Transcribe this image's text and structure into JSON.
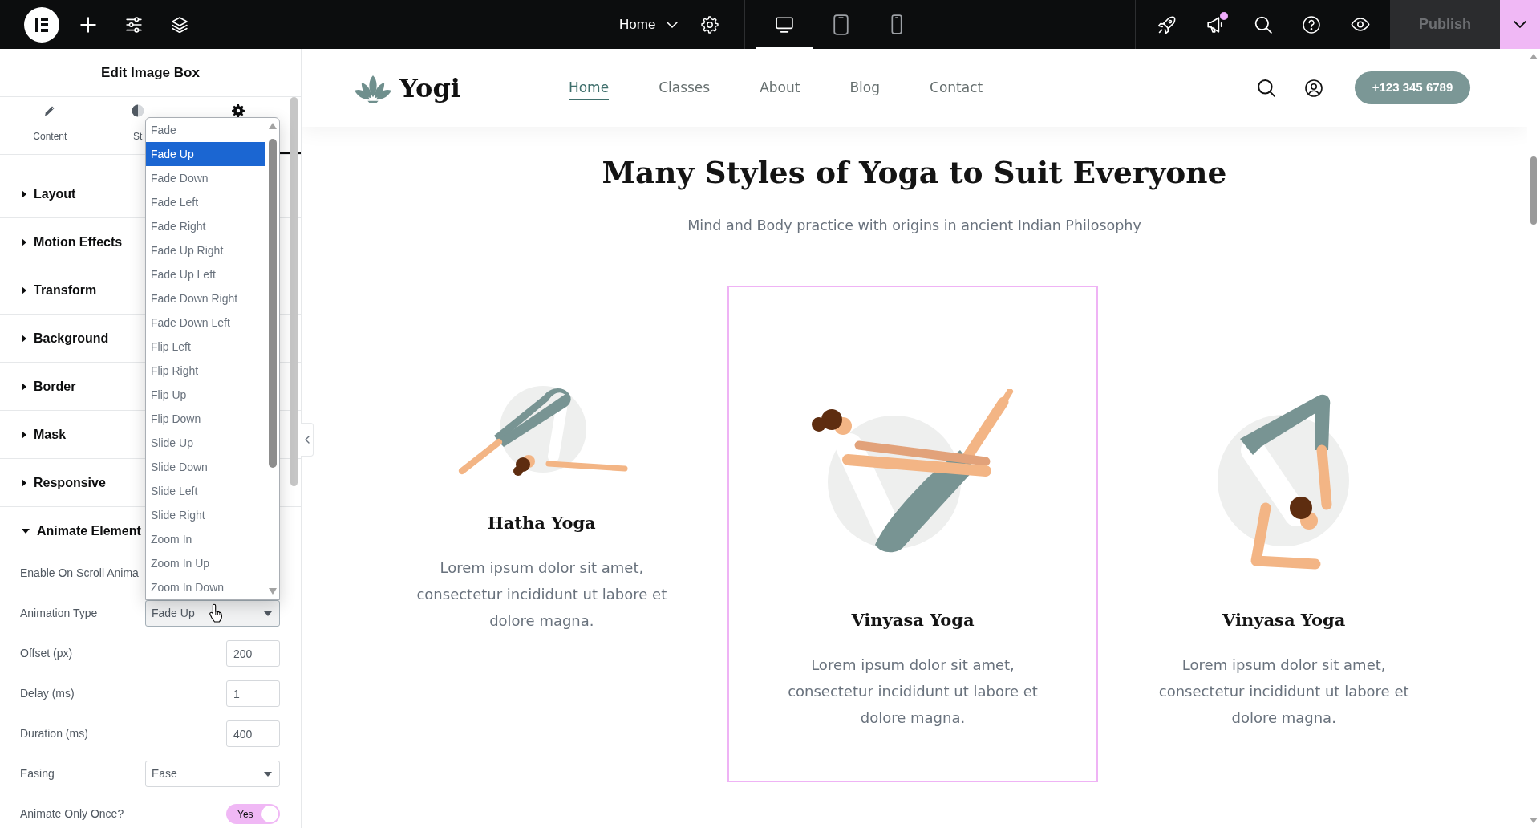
{
  "top_bar": {
    "page_selector": {
      "label": "Home"
    },
    "devices": [
      {
        "kind": "desktop",
        "selected": true
      },
      {
        "kind": "tablet",
        "selected": false
      },
      {
        "kind": "mobile",
        "selected": false
      }
    ],
    "announcements": {
      "unread": true
    },
    "publish_button": {
      "label": "Publish",
      "disabled": true
    }
  },
  "panel": {
    "title": "Edit Image Box",
    "tabs": [
      {
        "kind": "content",
        "label": "Content",
        "selected": false
      },
      {
        "kind": "style",
        "label": "St",
        "selected": false
      },
      {
        "kind": "advanced",
        "selected": true
      }
    ],
    "sections": [
      {
        "label": "Layout",
        "expanded": false
      },
      {
        "label": "Motion Effects",
        "expanded": false
      },
      {
        "label": "Transform",
        "expanded": false
      },
      {
        "label": "Background",
        "expanded": false
      },
      {
        "label": "Border",
        "expanded": false
      },
      {
        "label": "Mask",
        "expanded": false
      },
      {
        "label": "Responsive",
        "expanded": false
      },
      {
        "label": "Animate Element",
        "expanded": true,
        "fields": [
          {
            "kind": "label",
            "label": "Enable On Scroll Anima"
          },
          {
            "kind": "select",
            "label": "Animation Type",
            "value": "Fade Up",
            "open": true,
            "options": [
              {
                "label": "Fade",
                "selected": false
              },
              {
                "label": "Fade Up",
                "selected": true
              },
              {
                "label": "Fade Down",
                "selected": false
              },
              {
                "label": "Fade Left",
                "selected": false
              },
              {
                "label": "Fade Right",
                "selected": false
              },
              {
                "label": "Fade Up Right",
                "selected": false
              },
              {
                "label": "Fade Up Left",
                "selected": false
              },
              {
                "label": "Fade Down Right",
                "selected": false
              },
              {
                "label": "Fade Down Left",
                "selected": false
              },
              {
                "label": "Flip Left",
                "selected": false
              },
              {
                "label": "Flip Right",
                "selected": false
              },
              {
                "label": "Flip Up",
                "selected": false
              },
              {
                "label": "Flip Down",
                "selected": false
              },
              {
                "label": "Slide Up",
                "selected": false
              },
              {
                "label": "Slide Down",
                "selected": false
              },
              {
                "label": "Slide Left",
                "selected": false
              },
              {
                "label": "Slide Right",
                "selected": false
              },
              {
                "label": "Zoom In",
                "selected": false
              },
              {
                "label": "Zoom In Up",
                "selected": false
              },
              {
                "label": "Zoom In Down",
                "selected": false
              }
            ]
          },
          {
            "kind": "number",
            "label": "Offset (px)",
            "value": "200"
          },
          {
            "kind": "number",
            "label": "Delay (ms)",
            "value": "1"
          },
          {
            "kind": "number",
            "label": "Duration (ms)",
            "value": "400"
          },
          {
            "kind": "select",
            "label": "Easing",
            "value": "Ease"
          },
          {
            "kind": "switch",
            "label": "Animate Only Once?",
            "on": true,
            "value": "Yes"
          }
        ]
      }
    ]
  },
  "preview": {
    "logo": "Yogi",
    "nav": [
      {
        "label": "Home",
        "selected": true
      },
      {
        "label": "Classes",
        "selected": false
      },
      {
        "label": "About",
        "selected": false
      },
      {
        "label": "Blog",
        "selected": false
      },
      {
        "label": "Contact",
        "selected": false
      }
    ],
    "phone_button": "+123 345 6789",
    "heading": "Many Styles of Yoga to Suit Everyone",
    "subheading": "Mind and Body practice with origins in ancient Indian Philosophy",
    "cards": [
      {
        "title": "Hatha Yoga",
        "text": "Lorem ipsum dolor sit amet, consectetur incididunt ut labore et dolore magna.",
        "selected": false
      },
      {
        "title": "Vinyasa Yoga",
        "text": "Lorem ipsum dolor sit amet, consectetur incididunt ut labore et dolore magna.",
        "selected": true
      },
      {
        "title": "Vinyasa Yoga",
        "text": "Lorem ipsum dolor sit amet, consectetur incididunt ut labore et dolore magna.",
        "selected": false
      }
    ]
  }
}
